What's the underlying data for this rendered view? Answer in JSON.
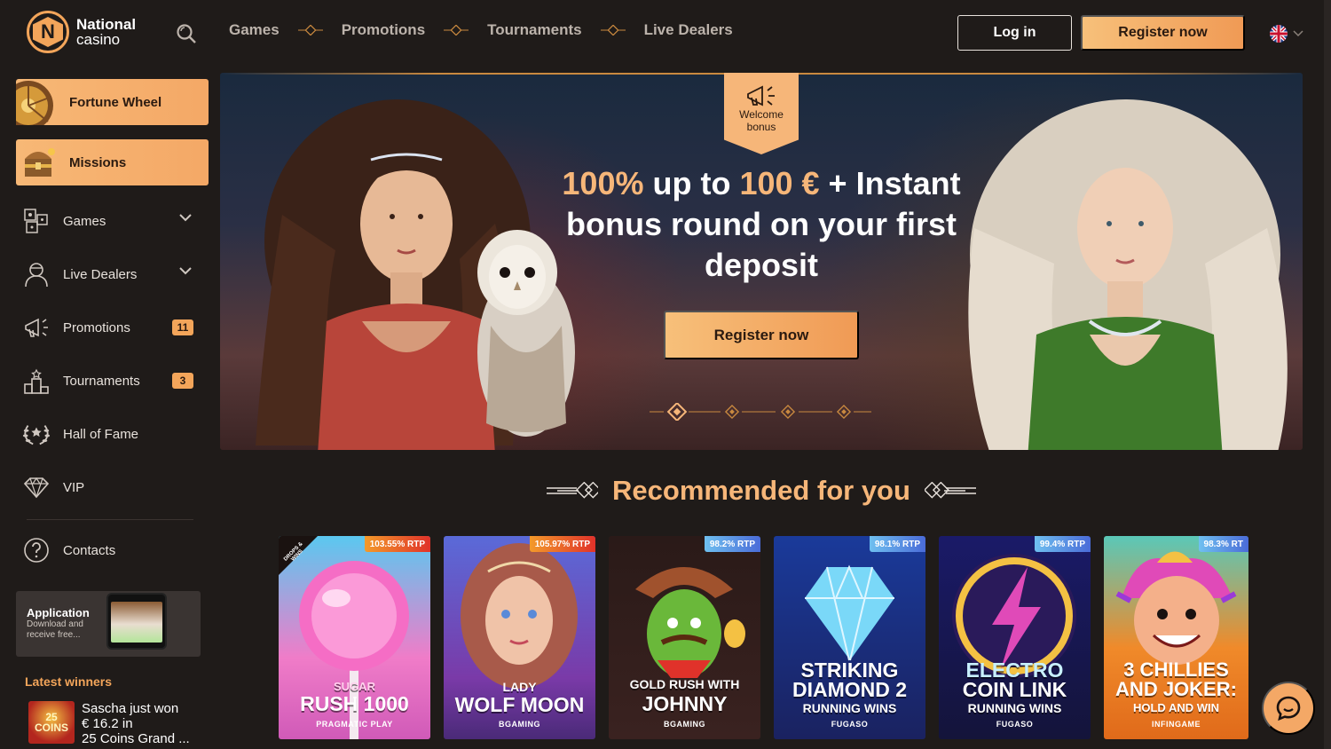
{
  "brand": {
    "name_line1": "National",
    "name_line2": "casino",
    "logo_letter": "N"
  },
  "topnav": {
    "items": [
      "Games",
      "Promotions",
      "Tournaments",
      "Live Dealers"
    ]
  },
  "header": {
    "login_label": "Log in",
    "register_label": "Register now"
  },
  "sidebar": {
    "promos": [
      {
        "label": "Fortune Wheel"
      },
      {
        "label": "Missions"
      }
    ],
    "items": [
      {
        "label": "Games"
      },
      {
        "label": "Live Dealers"
      },
      {
        "label": "Promotions",
        "badge": "11"
      },
      {
        "label": "Tournaments",
        "badge": "3"
      },
      {
        "label": "Hall of Fame"
      },
      {
        "label": "VIP"
      },
      {
        "label": "Contacts"
      }
    ],
    "app": {
      "title": "Application",
      "subtitle": "Download and receive free..."
    },
    "latest_title": "Latest winners",
    "winner": {
      "thumb_text": "25 COINS",
      "line1": "Sascha just won",
      "line2": "€ 16.2 in",
      "line3": "25 Coins Grand ..."
    }
  },
  "banner": {
    "tag_line1": "Welcome",
    "tag_line2": "bonus",
    "headline_part1": "100%",
    "headline_part2": " up to ",
    "headline_part3": "100 €",
    "headline_part4": " + Instant bonus round on your first deposit",
    "cta_label": "Register now"
  },
  "recommended": {
    "title": "Recommended for you",
    "games": [
      {
        "rtp": "103.55% RTP",
        "hot": true,
        "title_small": "SUGAR",
        "title_big": "RUSH 1000",
        "provider": "PRAGMATIC PLAY",
        "corner": "DROPS & WINS"
      },
      {
        "rtp": "105.97% RTP",
        "hot": true,
        "title_small": "LADY",
        "title_big": "WOLF MOON",
        "provider": "BGAMING"
      },
      {
        "rtp": "98.2% RTP",
        "hot": false,
        "title_small": "GOLD RUSH WITH",
        "title_big": "JOHNNY",
        "provider": "BGAMING"
      },
      {
        "rtp": "98.1% RTP",
        "hot": false,
        "title_small": "STRIKING",
        "title_big": "DIAMOND 2",
        "title_sub": "RUNNING WINS",
        "provider": "FUGASO"
      },
      {
        "rtp": "99.4% RTP",
        "hot": false,
        "title_small": "ELECTRO",
        "title_big": "COIN LINK",
        "title_sub": "RUNNING WINS",
        "provider": "FUGASO"
      },
      {
        "rtp": "98.3% RT",
        "hot": false,
        "title_small": "3 CHILLIES",
        "title_big": "AND JOKER:",
        "title_sub": "HOLD AND WIN",
        "provider": "INFINGAME"
      }
    ]
  },
  "colors": {
    "accent": "#f6b679",
    "background": "#1f1b19",
    "hot_badge": "#e0322a",
    "cold_badge": "#4a6bd8"
  }
}
